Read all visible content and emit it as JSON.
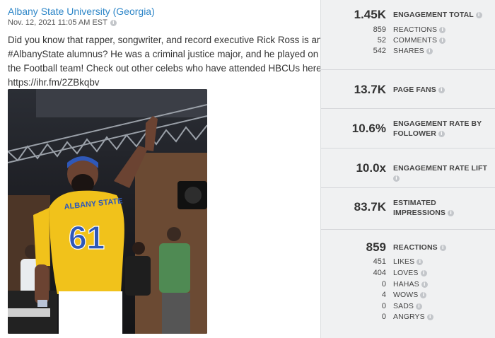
{
  "post": {
    "page_name": "Albany State University (Georgia)",
    "date": "Nov. 12, 2021 11:05 AM EST",
    "text_lines": [
      "Did you know that rapper, songwriter, and record executive Rick Ross is an",
      "#AlbanyState alumnus? He was a criminal justice major, and he played on",
      "the Football team! Check out other celebs who have attended HBCUs here:",
      "https://ihr.fm/2ZBkqbv"
    ],
    "jersey_text": "ALBANY STATE",
    "jersey_number": "61"
  },
  "metrics": {
    "engagement": {
      "value": "1.45K",
      "label": "ENGAGEMENT TOTAL",
      "rows": [
        {
          "value": "859",
          "label": "REACTIONS"
        },
        {
          "value": "52",
          "label": "COMMENTS"
        },
        {
          "value": "542",
          "label": "SHARES"
        }
      ]
    },
    "page_fans": {
      "value": "13.7K",
      "label": "PAGE FANS"
    },
    "rate_follower": {
      "value": "10.6%",
      "label_line1": "ENGAGEMENT RATE BY",
      "label_line2": "FOLLOWER"
    },
    "rate_lift": {
      "value": "10.0x",
      "label": "ENGAGEMENT RATE LIFT"
    },
    "impressions": {
      "value": "83.7K",
      "label_line1": "ESTIMATED",
      "label_line2": "IMPRESSIONS"
    },
    "reactions": {
      "value": "859",
      "label": "REACTIONS",
      "rows": [
        {
          "value": "451",
          "label": "LIKES"
        },
        {
          "value": "404",
          "label": "LOVES"
        },
        {
          "value": "0",
          "label": "HAHAS"
        },
        {
          "value": "4",
          "label": "WOWS"
        },
        {
          "value": "0",
          "label": "SADS"
        },
        {
          "value": "0",
          "label": "ANGRYS"
        }
      ]
    }
  }
}
